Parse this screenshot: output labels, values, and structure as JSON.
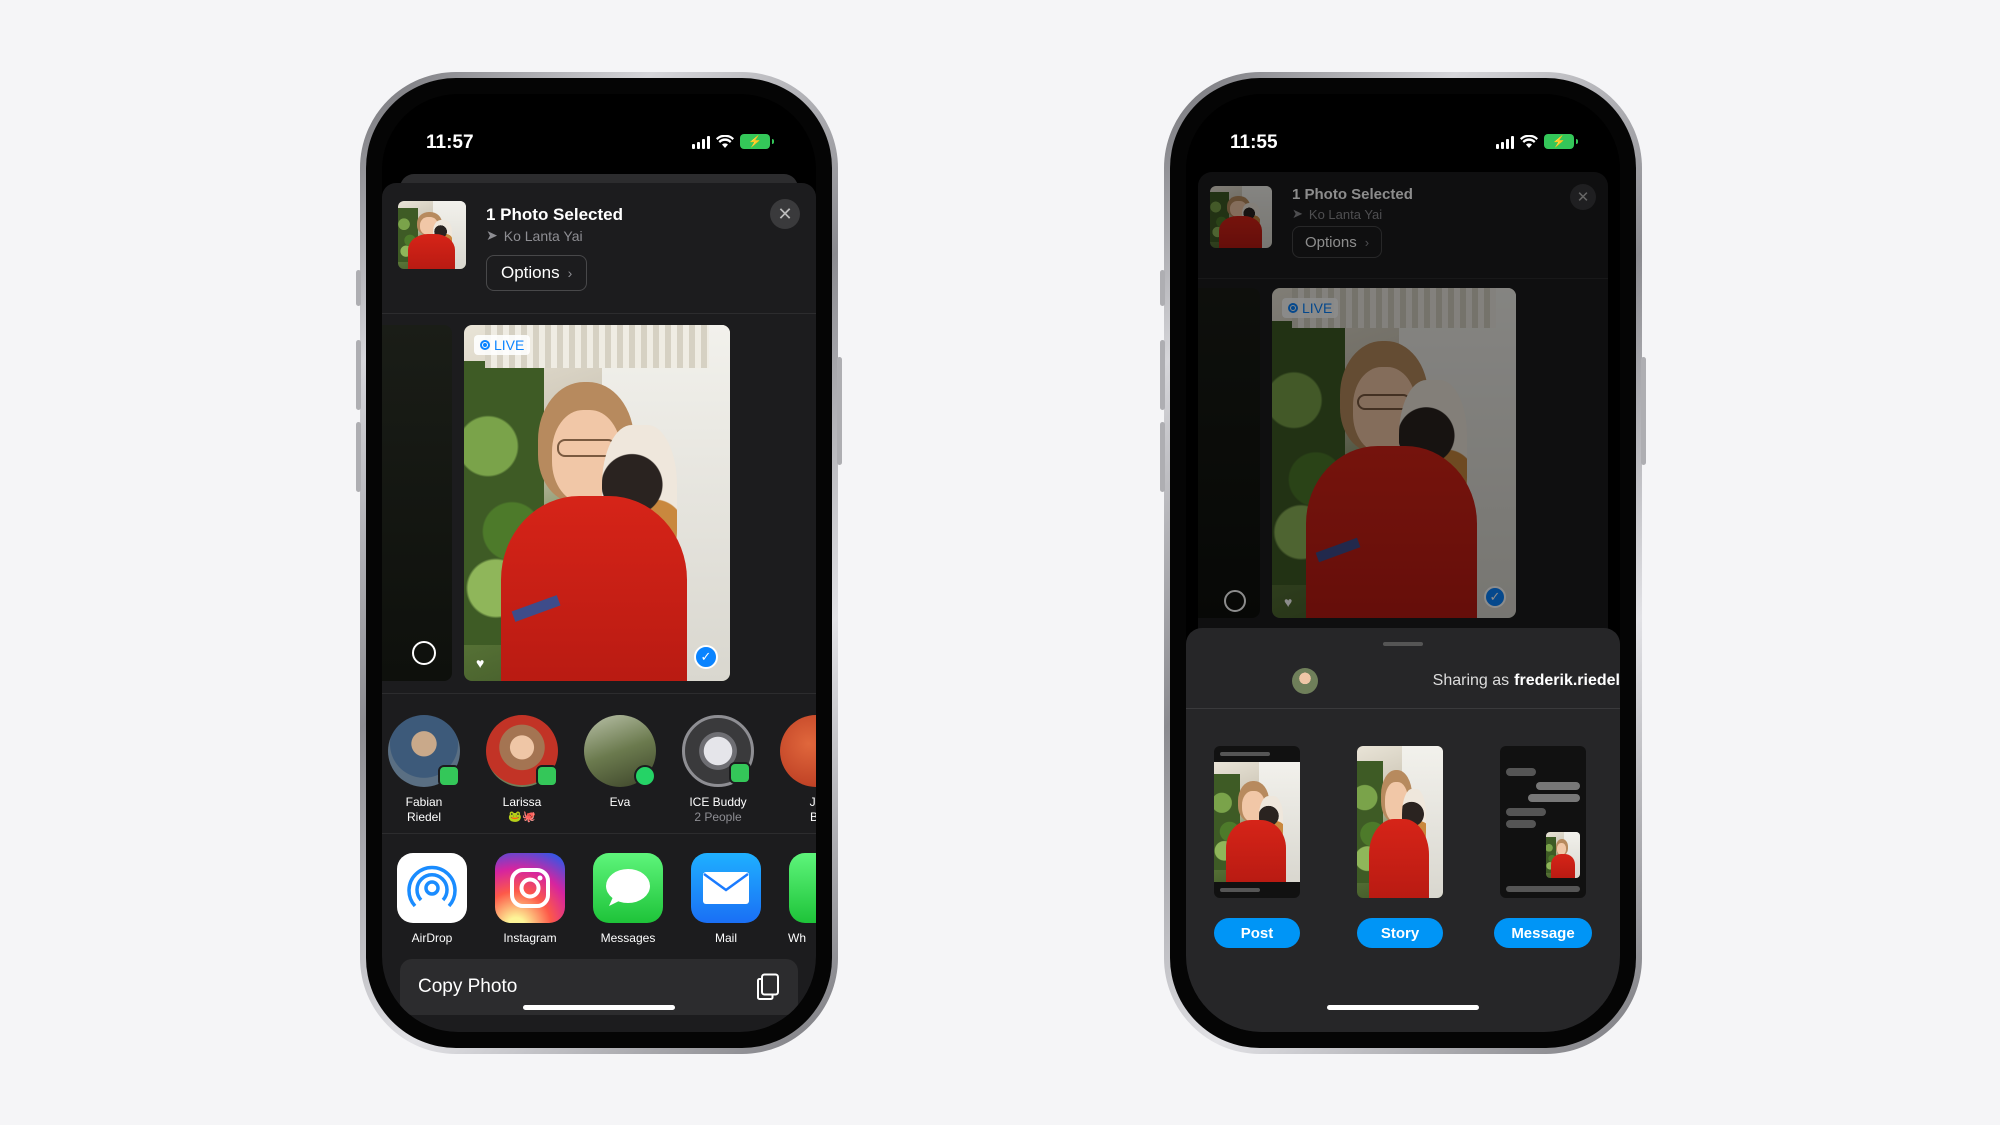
{
  "left_phone": {
    "status": {
      "time": "11:57"
    },
    "header": {
      "title": "1 Photo Selected",
      "location": "Ko Lanta Yai",
      "options_label": "Options"
    },
    "photo": {
      "live_label": "LIVE"
    },
    "people": [
      {
        "name": "Fabian",
        "name2": "Riedel",
        "sub": ""
      },
      {
        "name": "Larissa",
        "name2": "",
        "sub": "🐸🐙"
      },
      {
        "name": "Eva",
        "name2": "",
        "sub": ""
      },
      {
        "name": "ICE Buddy",
        "name2": "",
        "sub": "2 People"
      },
      {
        "name": "Jo",
        "name2": "Br",
        "sub": ""
      }
    ],
    "apps": [
      {
        "name": "AirDrop"
      },
      {
        "name": "Instagram"
      },
      {
        "name": "Messages"
      },
      {
        "name": "Mail"
      },
      {
        "name": "Wh"
      }
    ],
    "copy_label": "Copy Photo"
  },
  "right_phone": {
    "status": {
      "time": "11:55"
    },
    "header": {
      "title": "1 Photo Selected",
      "location": "Ko Lanta Yai",
      "options_label": "Options"
    },
    "photo": {
      "live_label": "LIVE"
    },
    "instagram": {
      "sharing_prefix": "Sharing as",
      "username": "frederik.riedel",
      "buttons": [
        "Post",
        "Story",
        "Message"
      ]
    }
  },
  "colors": {
    "accent": "#0a84ff",
    "instagram_blue": "#0095f6",
    "sheet": "#1c1c1e",
    "messages_green": "#34c759"
  }
}
